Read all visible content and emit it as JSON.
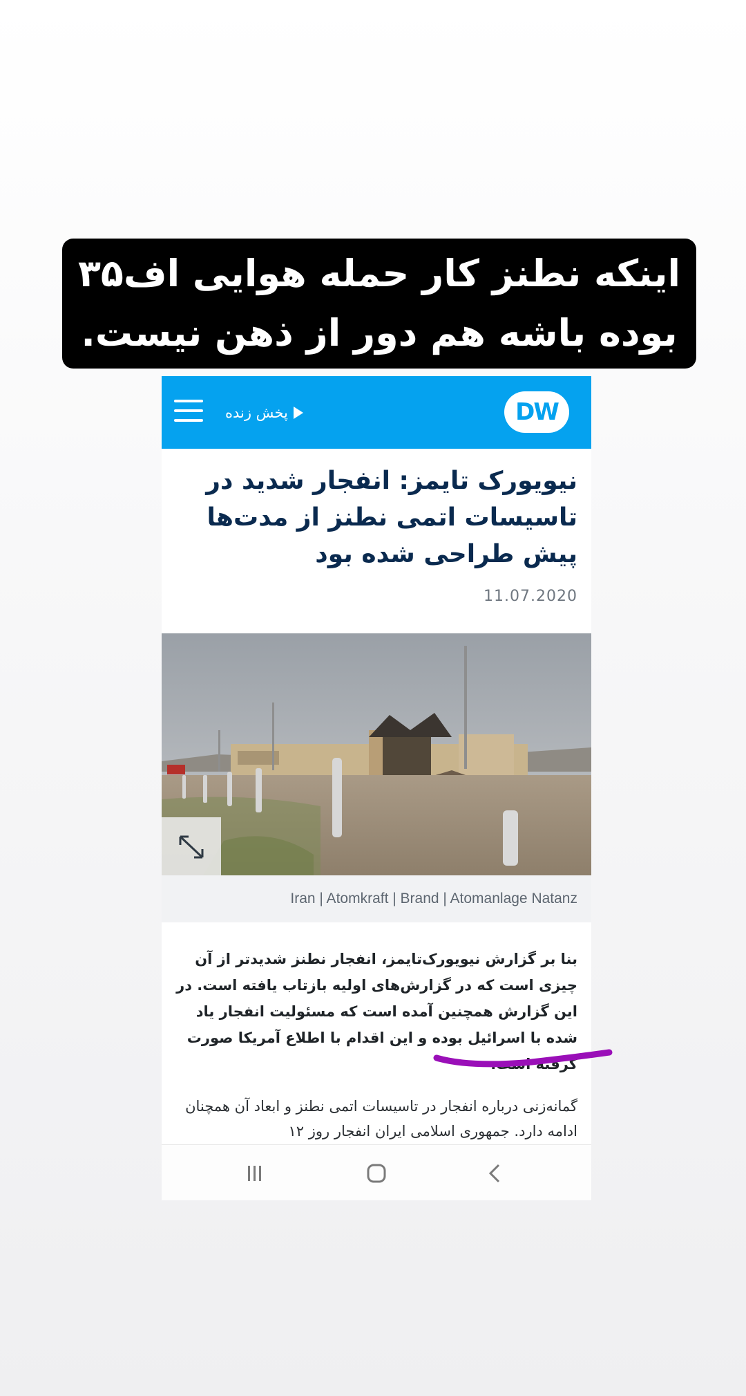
{
  "story_caption": {
    "line1": "اینکه نطنز کار حمله هوایی اف۳۵",
    "line2": "بوده باشه هم دور از ذهن نیست."
  },
  "header": {
    "live_label": "پخش زنده",
    "logo_text": "DW",
    "brand_color": "#05a2ef"
  },
  "article": {
    "headline": "نیویورک تایمز: انفجار شدید در تاسیسات اتمی نطنز از مدت‌ها پیش طراحی شده بود",
    "date": "11.07.2020",
    "image_caption": "Iran | Atomkraft | Brand | Atomanlage Natanz",
    "paragraph1": "بنا بر گزارش نیویورک‌تایمز، انفجار نطنز شدیدتر از آن چیزی است که در گزارش‌های اولیه بازتاب یافته است. در این گزارش همچنین آمده است که مسئولیت انفجار یاد شده با اسرائیل بوده و این اقدام با اطلاع آمریکا صورت گرفته است.",
    "paragraph2": "گمانه‌زنی درباره انفجار در تاسیسات اتمی نطنز و ابعاد آن همچنان ادامه دارد. جمهوری اسلامی ایران انفجار روز ۱۲"
  },
  "icons": {
    "menu": "hamburger-icon",
    "live": "play-icon",
    "expand": "expand-icon",
    "recents": "recents-icon",
    "home": "home-icon",
    "back": "back-icon"
  },
  "annotation_color": "#9a0fb8"
}
